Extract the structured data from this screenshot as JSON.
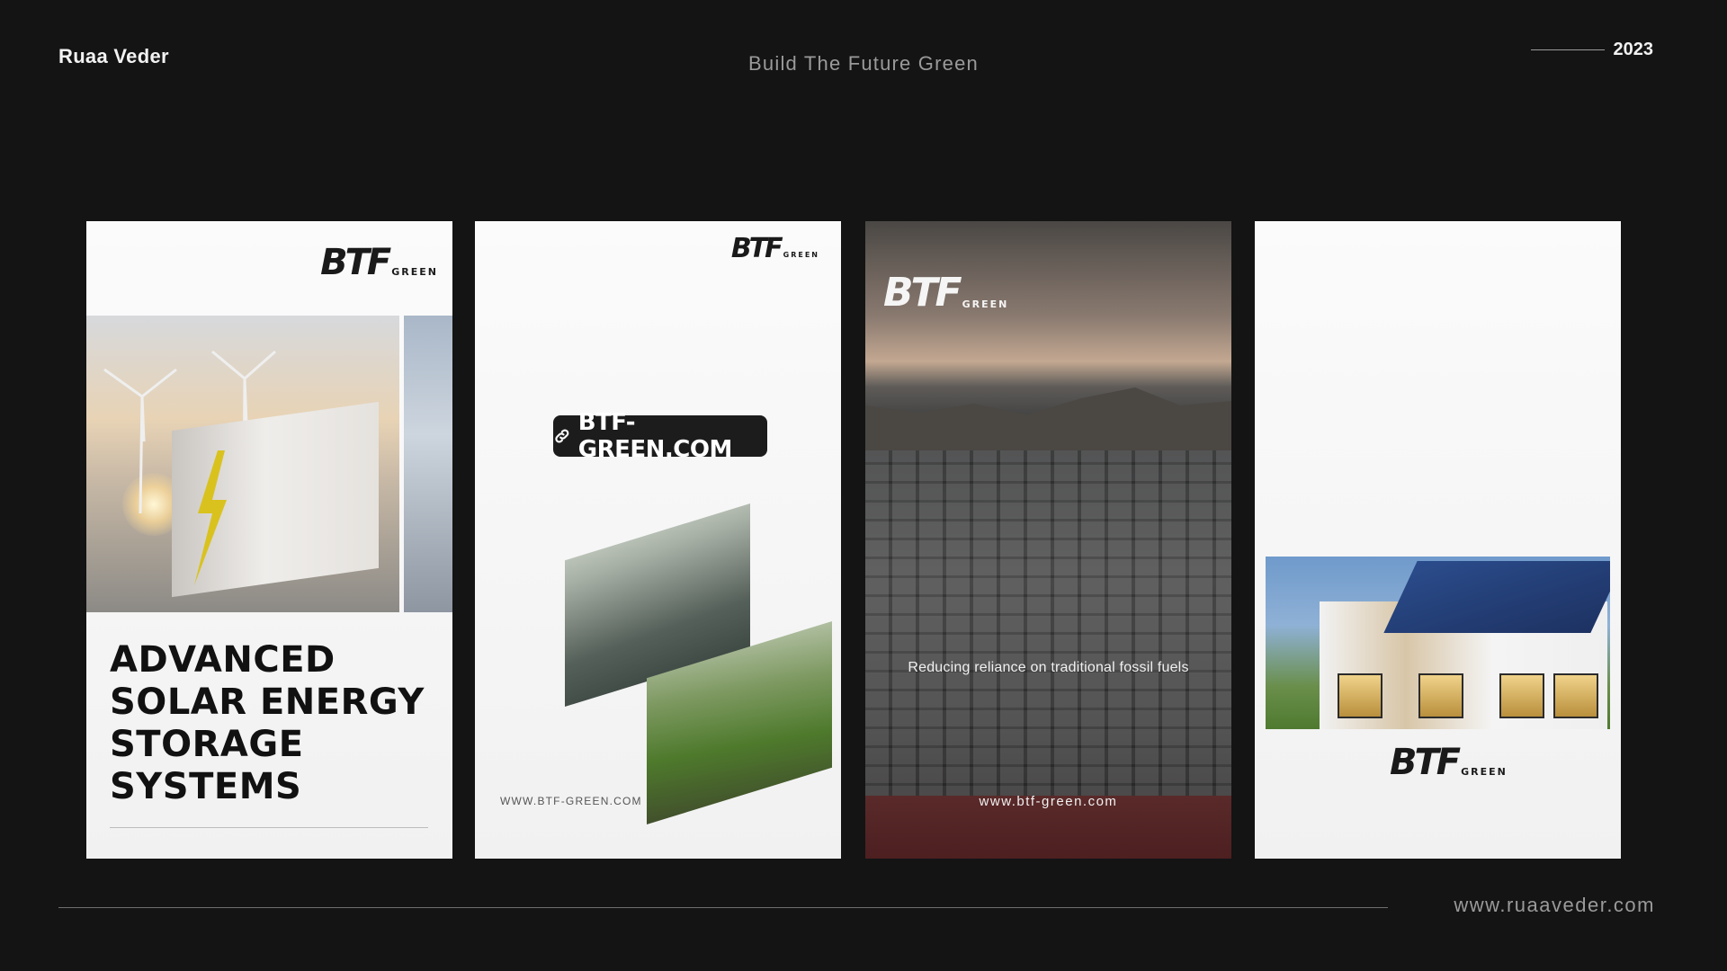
{
  "header": {
    "brand": "Ruaa Veder",
    "tagline": "Build The Future Green",
    "year": "2023"
  },
  "footer": {
    "url": "www.ruaaveder.com"
  },
  "logo": {
    "mark": "BTF",
    "sub": "GREEN"
  },
  "cards": [
    {
      "title": "ADVANCED\nSOLAR ENERGY\nSTORAGE\nSYSTEMS"
    },
    {
      "chip_text": "BTF-GREEN.COM",
      "url": "WWW.BTF-GREEN.COM"
    },
    {
      "caption": "Reducing reliance on traditional fossil fuels",
      "url": "www.btf-green.com"
    },
    {}
  ]
}
